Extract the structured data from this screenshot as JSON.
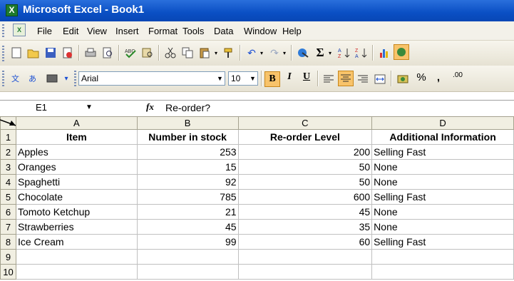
{
  "window": {
    "title": "Microsoft Excel - Book1"
  },
  "menu": [
    "File",
    "Edit",
    "View",
    "Insert",
    "Format",
    "Tools",
    "Data",
    "Window",
    "Help"
  ],
  "format_toolbar": {
    "font_name": "Arial",
    "font_size": "10",
    "bold": "B",
    "italic": "I",
    "underline": "U",
    "percent": "%",
    "comma": ",",
    "decimal": ".00"
  },
  "formula_bar": {
    "name_box": "E1",
    "fx": "fx",
    "formula": "Re-order?"
  },
  "columns": [
    "A",
    "B",
    "C",
    "D"
  ],
  "rows": [
    {
      "num": "1",
      "cells": [
        "Item",
        "Number in stock",
        "Re-order Level",
        "Additional Information"
      ]
    },
    {
      "num": "2",
      "cells": [
        "Apples",
        "253",
        "200",
        "Selling Fast"
      ]
    },
    {
      "num": "3",
      "cells": [
        "Oranges",
        "15",
        "50",
        "None"
      ]
    },
    {
      "num": "4",
      "cells": [
        "Spaghetti",
        "92",
        "50",
        "None"
      ]
    },
    {
      "num": "5",
      "cells": [
        "Chocolate",
        "785",
        "600",
        "Selling Fast"
      ]
    },
    {
      "num": "6",
      "cells": [
        "Tomoto Ketchup",
        "21",
        "45",
        "None"
      ]
    },
    {
      "num": "7",
      "cells": [
        "Strawberries",
        "45",
        "35",
        "None"
      ]
    },
    {
      "num": "8",
      "cells": [
        "Ice Cream",
        "99",
        "60",
        "Selling Fast"
      ]
    },
    {
      "num": "9",
      "cells": [
        "",
        "",
        "",
        ""
      ]
    },
    {
      "num": "10",
      "cells": [
        "",
        "",
        "",
        ""
      ]
    }
  ]
}
